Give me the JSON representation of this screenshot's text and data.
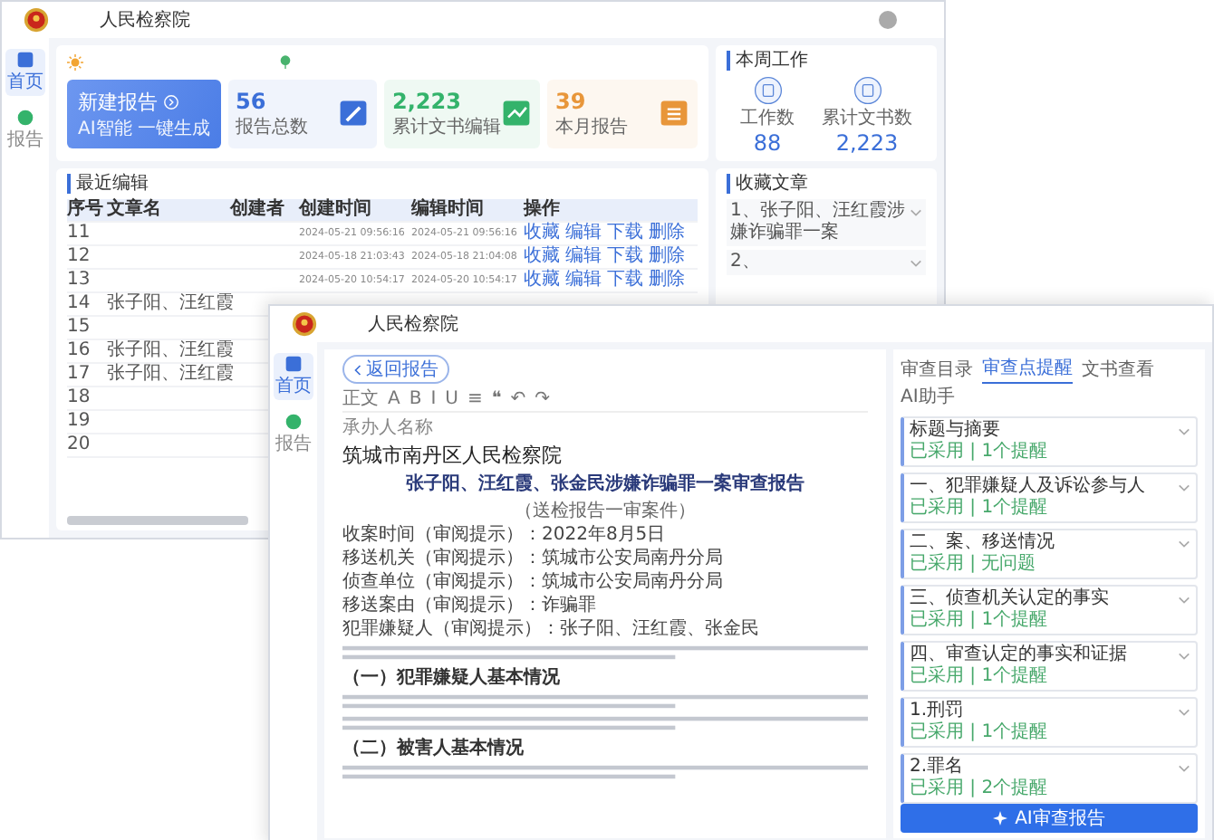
{
  "back_window": {
    "title": "人民检察院",
    "nav": [
      {
        "label": "首页",
        "selected": true
      },
      {
        "label": "报告",
        "selected": false
      }
    ],
    "new_report": {
      "title": "新建报告",
      "subtitle": "AI智能 一键生成"
    },
    "stats": [
      {
        "value": "56",
        "label": "报告总数",
        "color": "#3b6fd8"
      },
      {
        "value": "2,223",
        "label": "累计文书编辑",
        "color": "#34b36b"
      },
      {
        "value": "39",
        "label": "本月报告",
        "color": "#e8963a"
      }
    ],
    "weekly": {
      "title": "本周工作",
      "items": [
        {
          "label": "工作数",
          "value": "88"
        },
        {
          "label": "累计文书数",
          "value": "2,223"
        }
      ]
    },
    "recent": {
      "title": "最近编辑",
      "columns": [
        "序号",
        "文章名",
        "创建者",
        "创建时间",
        "编辑时间",
        "操作"
      ],
      "rows": [
        {
          "no": "11",
          "created": "2024-05-21 09:56:16",
          "edited": "2024-05-21 09:56:16",
          "actions": [
            "收藏",
            "编辑",
            "下载",
            "删除"
          ]
        },
        {
          "no": "12",
          "created": "2024-05-18 21:03:43",
          "edited": "2024-05-18 21:04:08",
          "actions": [
            "收藏",
            "编辑",
            "下载",
            "删除"
          ]
        },
        {
          "no": "13",
          "created": "2024-05-20 10:54:17",
          "edited": "2024-05-20 10:54:17",
          "actions": [
            "收藏",
            "编辑",
            "下载",
            "删除"
          ]
        },
        {
          "no": "14",
          "name": "张子阳、汪红霞"
        },
        {
          "no": "15"
        },
        {
          "no": "16",
          "name": "张子阳、汪红霞"
        },
        {
          "no": "17",
          "name": "张子阳、汪红霞"
        },
        {
          "no": "18"
        },
        {
          "no": "19"
        },
        {
          "no": "20"
        }
      ]
    },
    "favorites": {
      "title": "收藏文章",
      "items": [
        "1、张子阳、汪红霞涉嫌诈骗罪一案",
        "2、"
      ]
    }
  },
  "front_window": {
    "title": "人民检察院",
    "nav": [
      {
        "label": "首页",
        "selected": true
      },
      {
        "label": "报告",
        "selected": false
      }
    ],
    "document": {
      "back_label": "返回报告",
      "toolbar": [
        "正文",
        "A",
        "B",
        "I",
        "U",
        "≡",
        "❝",
        "↶",
        "↷"
      ],
      "recipient_label": "承办人名称",
      "org": "筑城市南丹区人民检察院",
      "heading": "张子阳、汪红霞、张金民涉嫌诈骗罪一案审查报告",
      "subheading": "（送检报告一审案件）",
      "fields": [
        "收案时间（审阅提示）：2022年8月5日",
        "移送机关（审阅提示）：筑城市公安局南丹分局",
        "侦查单位（审阅提示）：筑城市公安局南丹分局",
        "移送案由（审阅提示）：诈骗罪",
        "犯罪嫌疑人（审阅提示）：张子阳、汪红霞、张金民"
      ],
      "blocks": [
        {
          "kind": "paragraph"
        },
        {
          "kind": "heading",
          "text": "（一）犯罪嫌疑人基本情况"
        },
        {
          "kind": "paragraph"
        },
        {
          "kind": "paragraph"
        },
        {
          "kind": "heading",
          "text": "（二）被害人基本情况"
        },
        {
          "kind": "paragraph"
        }
      ]
    },
    "panel": {
      "tabs": [
        {
          "label": "审查目录",
          "selected": false
        },
        {
          "label": "审查点提醒",
          "selected": true
        },
        {
          "label": "文书查看",
          "selected": false
        },
        {
          "label": "AI助手",
          "selected": false
        }
      ],
      "items": [
        {
          "title": "标题与摘要",
          "note": "已采用 | 1个提醒"
        },
        {
          "title": "一、犯罪嫌疑人及诉讼参与人",
          "note": "已采用 | 1个提醒"
        },
        {
          "title": "二、案、移送情况",
          "note": "已采用 | 无问题"
        },
        {
          "title": "三、侦查机关认定的事实",
          "note": "已采用 | 1个提醒"
        },
        {
          "title": "四、审查认定的事实和证据",
          "note": "已采用 | 1个提醒"
        },
        {
          "title": "1.刑罚",
          "note": "已采用 | 1个提醒"
        },
        {
          "title": "2.罪名",
          "note": "已采用 | 2个提醒"
        }
      ],
      "button": "AI审查报告"
    }
  }
}
